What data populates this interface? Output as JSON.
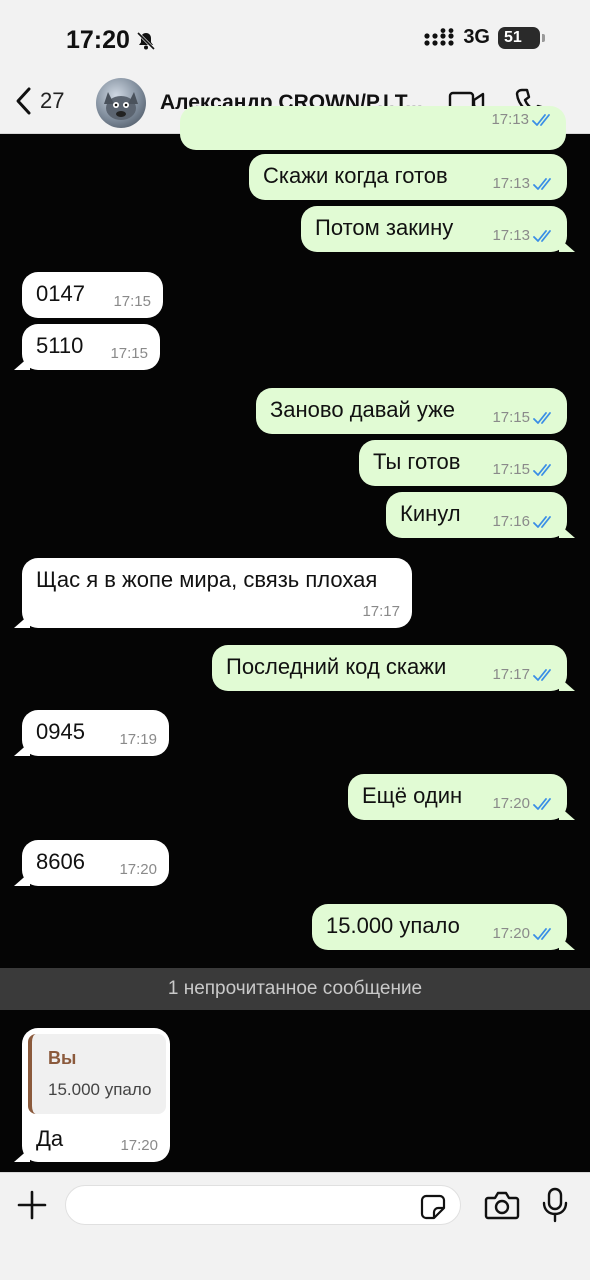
{
  "status_bar": {
    "time": "17:20",
    "network": "3G",
    "battery": "51"
  },
  "header": {
    "back_count": "27",
    "contact_name": "Александр CROWN/P.I.T..."
  },
  "messages": [
    {
      "dir": "out",
      "text": "",
      "time": "17:13",
      "partial": true
    },
    {
      "dir": "out",
      "text": "Скажи когда готов",
      "time": "17:13"
    },
    {
      "dir": "out",
      "text": "Потом закину",
      "time": "17:13"
    },
    {
      "dir": "in",
      "text": "0147",
      "time": "17:15"
    },
    {
      "dir": "in",
      "text": "5110",
      "time": "17:15"
    },
    {
      "dir": "out",
      "text": "Заново давай уже",
      "time": "17:15"
    },
    {
      "dir": "out",
      "text": "Ты готов",
      "time": "17:15"
    },
    {
      "dir": "out",
      "text": "Кинул",
      "time": "17:16"
    },
    {
      "dir": "in",
      "text": "Щас я в жопе мира, связь плохая",
      "time": "17:17"
    },
    {
      "dir": "out",
      "text": "Последний код скажи",
      "time": "17:17"
    },
    {
      "dir": "in",
      "text": "0945",
      "time": "17:19"
    },
    {
      "dir": "out",
      "text": "Ещё один",
      "time": "17:20"
    },
    {
      "dir": "in",
      "text": "8606",
      "time": "17:20"
    },
    {
      "dir": "out",
      "text": "15.000 упало",
      "time": "17:20"
    }
  ],
  "unread_divider": "1 непрочитанное сообщение",
  "reply_message": {
    "quote_author": "Вы",
    "quote_text": "15.000 упало",
    "text": "Да",
    "time": "17:20"
  },
  "input": {
    "placeholder": ""
  },
  "colors": {
    "outgoing_bubble": "#e1fbd4",
    "incoming_bubble": "#ffffff",
    "tick_blue": "#3a8ee6",
    "quote_accent": "#8b5a3c"
  }
}
